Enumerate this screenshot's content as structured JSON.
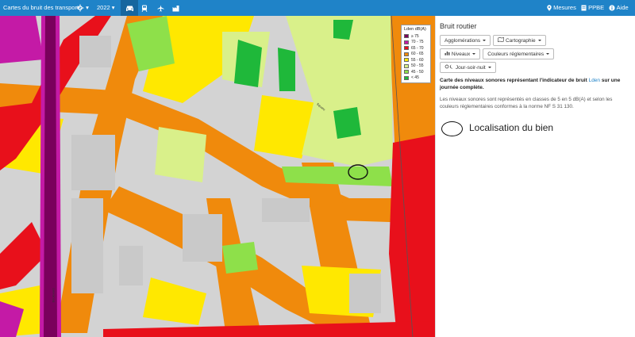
{
  "topbar": {
    "app_title": "Cartes du bruit des transports",
    "year": "2022",
    "right_items": [
      "Mesures",
      "PPBE",
      "Aide"
    ],
    "icons": [
      "location-settings-icon",
      "car-icon",
      "train-icon",
      "plane-icon",
      "industry-icon"
    ]
  },
  "legend": {
    "title": "Lden dB(A)",
    "rows": [
      {
        "label": "≥ 75",
        "color": "#7a005c"
      },
      {
        "label": "70 - 75",
        "color": "#c41aa6"
      },
      {
        "label": "65 - 70",
        "color": "#e8101b"
      },
      {
        "label": "60 - 65",
        "color": "#f08a0c"
      },
      {
        "label": "55 - 60",
        "color": "#ffe800"
      },
      {
        "label": "50 - 55",
        "color": "#d9f08a"
      },
      {
        "label": "45 - 50",
        "color": "#8ee04a"
      },
      {
        "label": "< 45",
        "color": "#1fb83a"
      }
    ]
  },
  "panel": {
    "title": "Bruit routier",
    "buttons_row1": [
      "Agglomérations",
      "Cartographie"
    ],
    "buttons_row2": [
      "Niveaux",
      "Couleurs réglementaires"
    ],
    "buttons_row3": [
      "Jour-soir-nuit"
    ],
    "description_pre": "Carte des niveaux sonores représentant l'indicateur de bruit ",
    "description_link": "Lden",
    "description_post": " sur une journée complète.",
    "note": "Les niveaux sonores sont représentés en classes de 5 en 5 dB(A) et selon les couleurs réglementaires conformes à la norme NF S 31 130."
  },
  "annotation": {
    "label": "Localisation du bien"
  }
}
